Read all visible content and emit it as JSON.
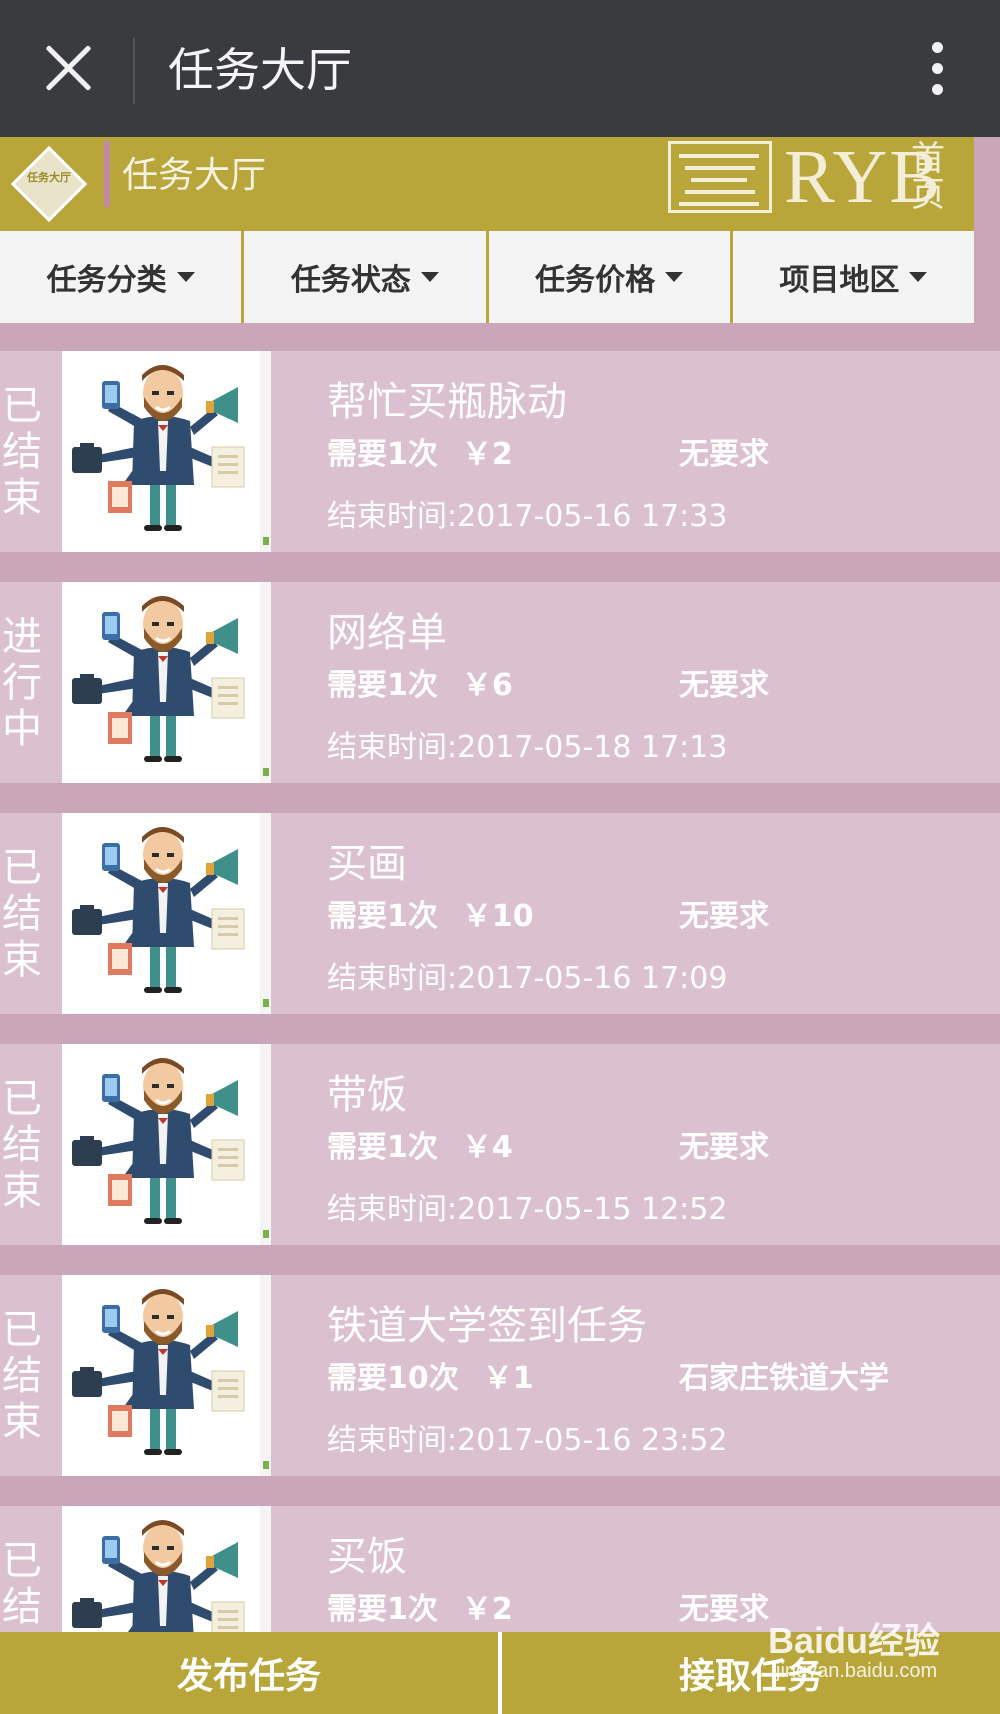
{
  "appbar": {
    "title": "任务大厅"
  },
  "banner": {
    "logo_text": "任务大厅",
    "title": "任务大厅",
    "brand": "RYB",
    "home_label": "首页"
  },
  "filters": [
    {
      "label": "任务分类"
    },
    {
      "label": "任务状态"
    },
    {
      "label": "任务价格"
    },
    {
      "label": "项目地区"
    }
  ],
  "tasks": [
    {
      "status": "已结束",
      "name": "帮忙买瓶脉动",
      "times": "需要1次",
      "price": "￥2",
      "requirement": "无要求",
      "end_time": "结束时间:2017-05-16 17:33"
    },
    {
      "status": "进行中",
      "name": "网络单",
      "times": "需要1次",
      "price": "￥6",
      "requirement": "无要求",
      "end_time": "结束时间:2017-05-18 17:13"
    },
    {
      "status": "已结束",
      "name": "买画",
      "times": "需要1次",
      "price": "￥10",
      "requirement": "无要求",
      "end_time": "结束时间:2017-05-16 17:09"
    },
    {
      "status": "已结束",
      "name": "带饭",
      "times": "需要1次",
      "price": "￥4",
      "requirement": "无要求",
      "end_time": "结束时间:2017-05-15 12:52"
    },
    {
      "status": "已结束",
      "name": "铁道大学签到任务",
      "times": "需要10次",
      "price": "￥1",
      "requirement": "石家庄铁道大学",
      "end_time": "结束时间:2017-05-16 23:52"
    },
    {
      "status": "已结束",
      "name": "买饭",
      "times": "需要1次",
      "price": "￥2",
      "requirement": "无要求",
      "end_time": ""
    }
  ],
  "bottom": {
    "publish": "发布任务",
    "accept": "接取任务"
  },
  "watermark": {
    "brand": "Baidu经验",
    "url": "jingyan.baidu.com"
  },
  "colors": {
    "accent": "#b8a63a",
    "appbar": "#3a3b3f",
    "card": "#dbc0cf",
    "page_bg": "#c9a6b8"
  }
}
